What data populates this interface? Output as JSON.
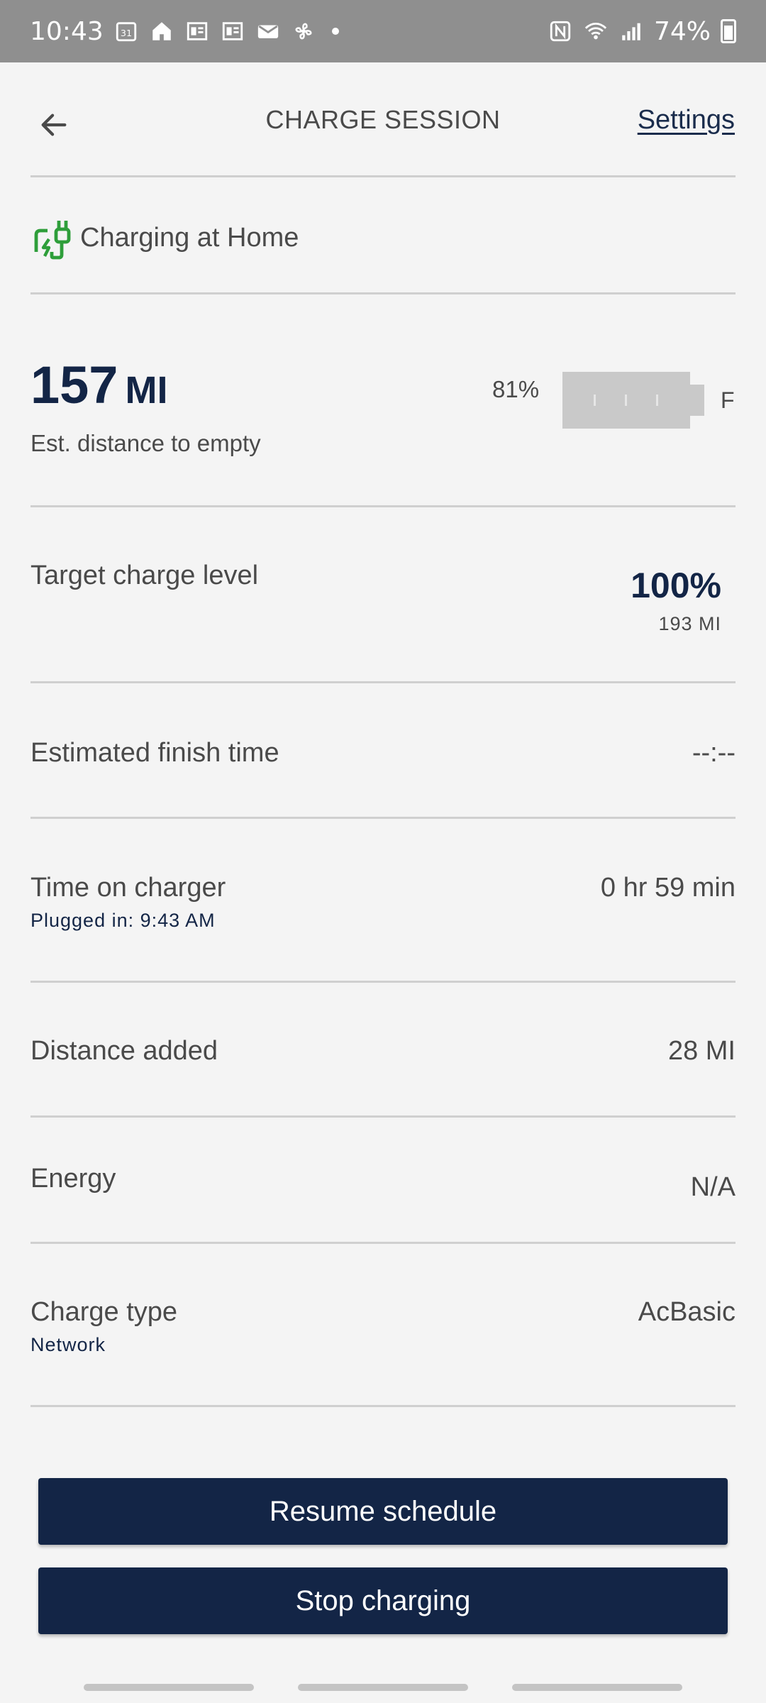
{
  "status_bar": {
    "time": "10:43",
    "battery": "74%"
  },
  "header": {
    "title": "CHARGE SESSION",
    "settings_label": "Settings"
  },
  "location": {
    "label": "Charging at Home"
  },
  "range": {
    "value": "157",
    "unit": "MI",
    "label": "Est. distance to empty",
    "battery_percent": "81%",
    "battery_full_label": "F"
  },
  "rows": {
    "target": {
      "label": "Target charge level",
      "value": "100%",
      "sub_value": "193 MI"
    },
    "finish": {
      "label": "Estimated finish time",
      "value": "--:--"
    },
    "time_on_charger": {
      "label": "Time on charger",
      "sub": "Plugged in: 9:43 AM",
      "value": "0 hr 59 min"
    },
    "distance": {
      "label": "Distance added",
      "value": "28 MI"
    },
    "energy": {
      "label": "Energy",
      "value": "N/A"
    },
    "charge_type": {
      "label": "Charge type",
      "sub": "Network",
      "value": "AcBasic"
    }
  },
  "buttons": {
    "resume": "Resume schedule",
    "stop": "Stop charging"
  },
  "colors": {
    "primary": "#132546",
    "plug_icon": "#2e9e3a",
    "background": "#f4f4f4"
  },
  "icons": {
    "back": "arrow-left-icon",
    "plug": "charging-plug-icon"
  }
}
